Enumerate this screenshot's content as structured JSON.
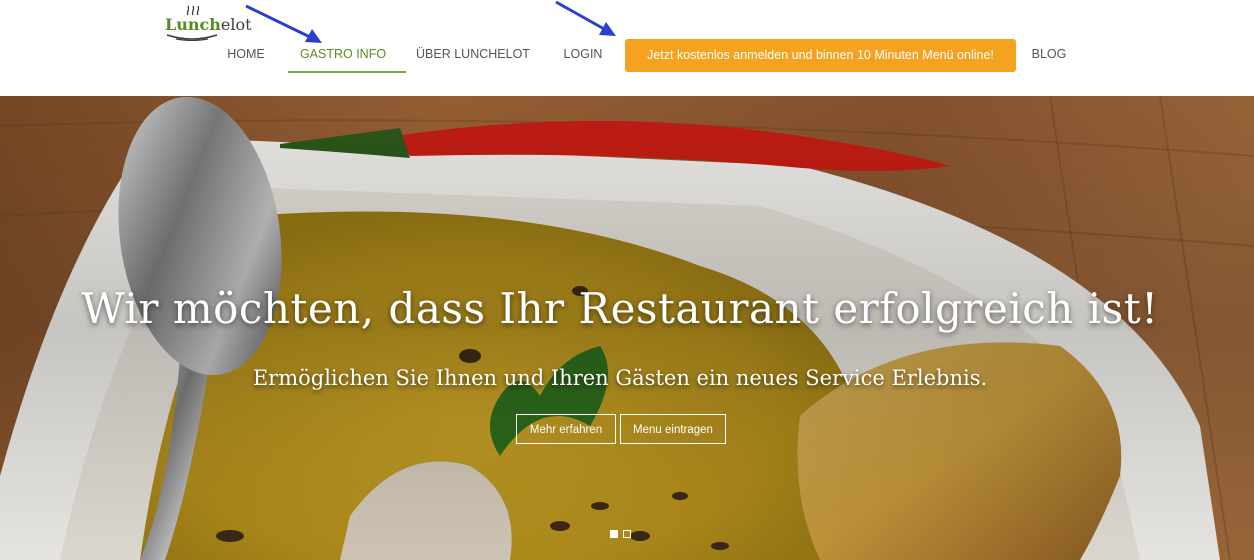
{
  "logo": {
    "text_part1": "Lunch",
    "text_part2": "elot",
    "brand_green": "#5a8a1f"
  },
  "nav": {
    "items": [
      {
        "label": "HOME",
        "active": false
      },
      {
        "label": "GASTRO INFO",
        "active": true
      },
      {
        "label": "ÜBER LUNCHELOT",
        "active": false
      },
      {
        "label": "LOGIN",
        "active": false
      }
    ],
    "cta_label": "Jetzt kostenlos anmelden und binnen 10 Minuten Menü online!",
    "blog_label": "BLOG",
    "cta_color": "#f4a21f",
    "active_color": "#7aa53a"
  },
  "annotations": {
    "arrow_color": "#2a3fcf",
    "arrows": [
      "arrow-to-gastro-info",
      "arrow-to-signup-cta"
    ]
  },
  "hero": {
    "title": "Wir möchten, dass Ihr Restaurant erfolgreich ist!",
    "subtitle": "Ermöglichen Sie Ihnen und Ihren Gästen ein neues Service Erlebnis.",
    "button_more": "Mehr erfahren",
    "button_menu": "Menu eintragen",
    "image_description_icon": "soup-plate-with-chili-spoon-bread-image",
    "carousel": {
      "slides": 2,
      "active": 1
    }
  }
}
